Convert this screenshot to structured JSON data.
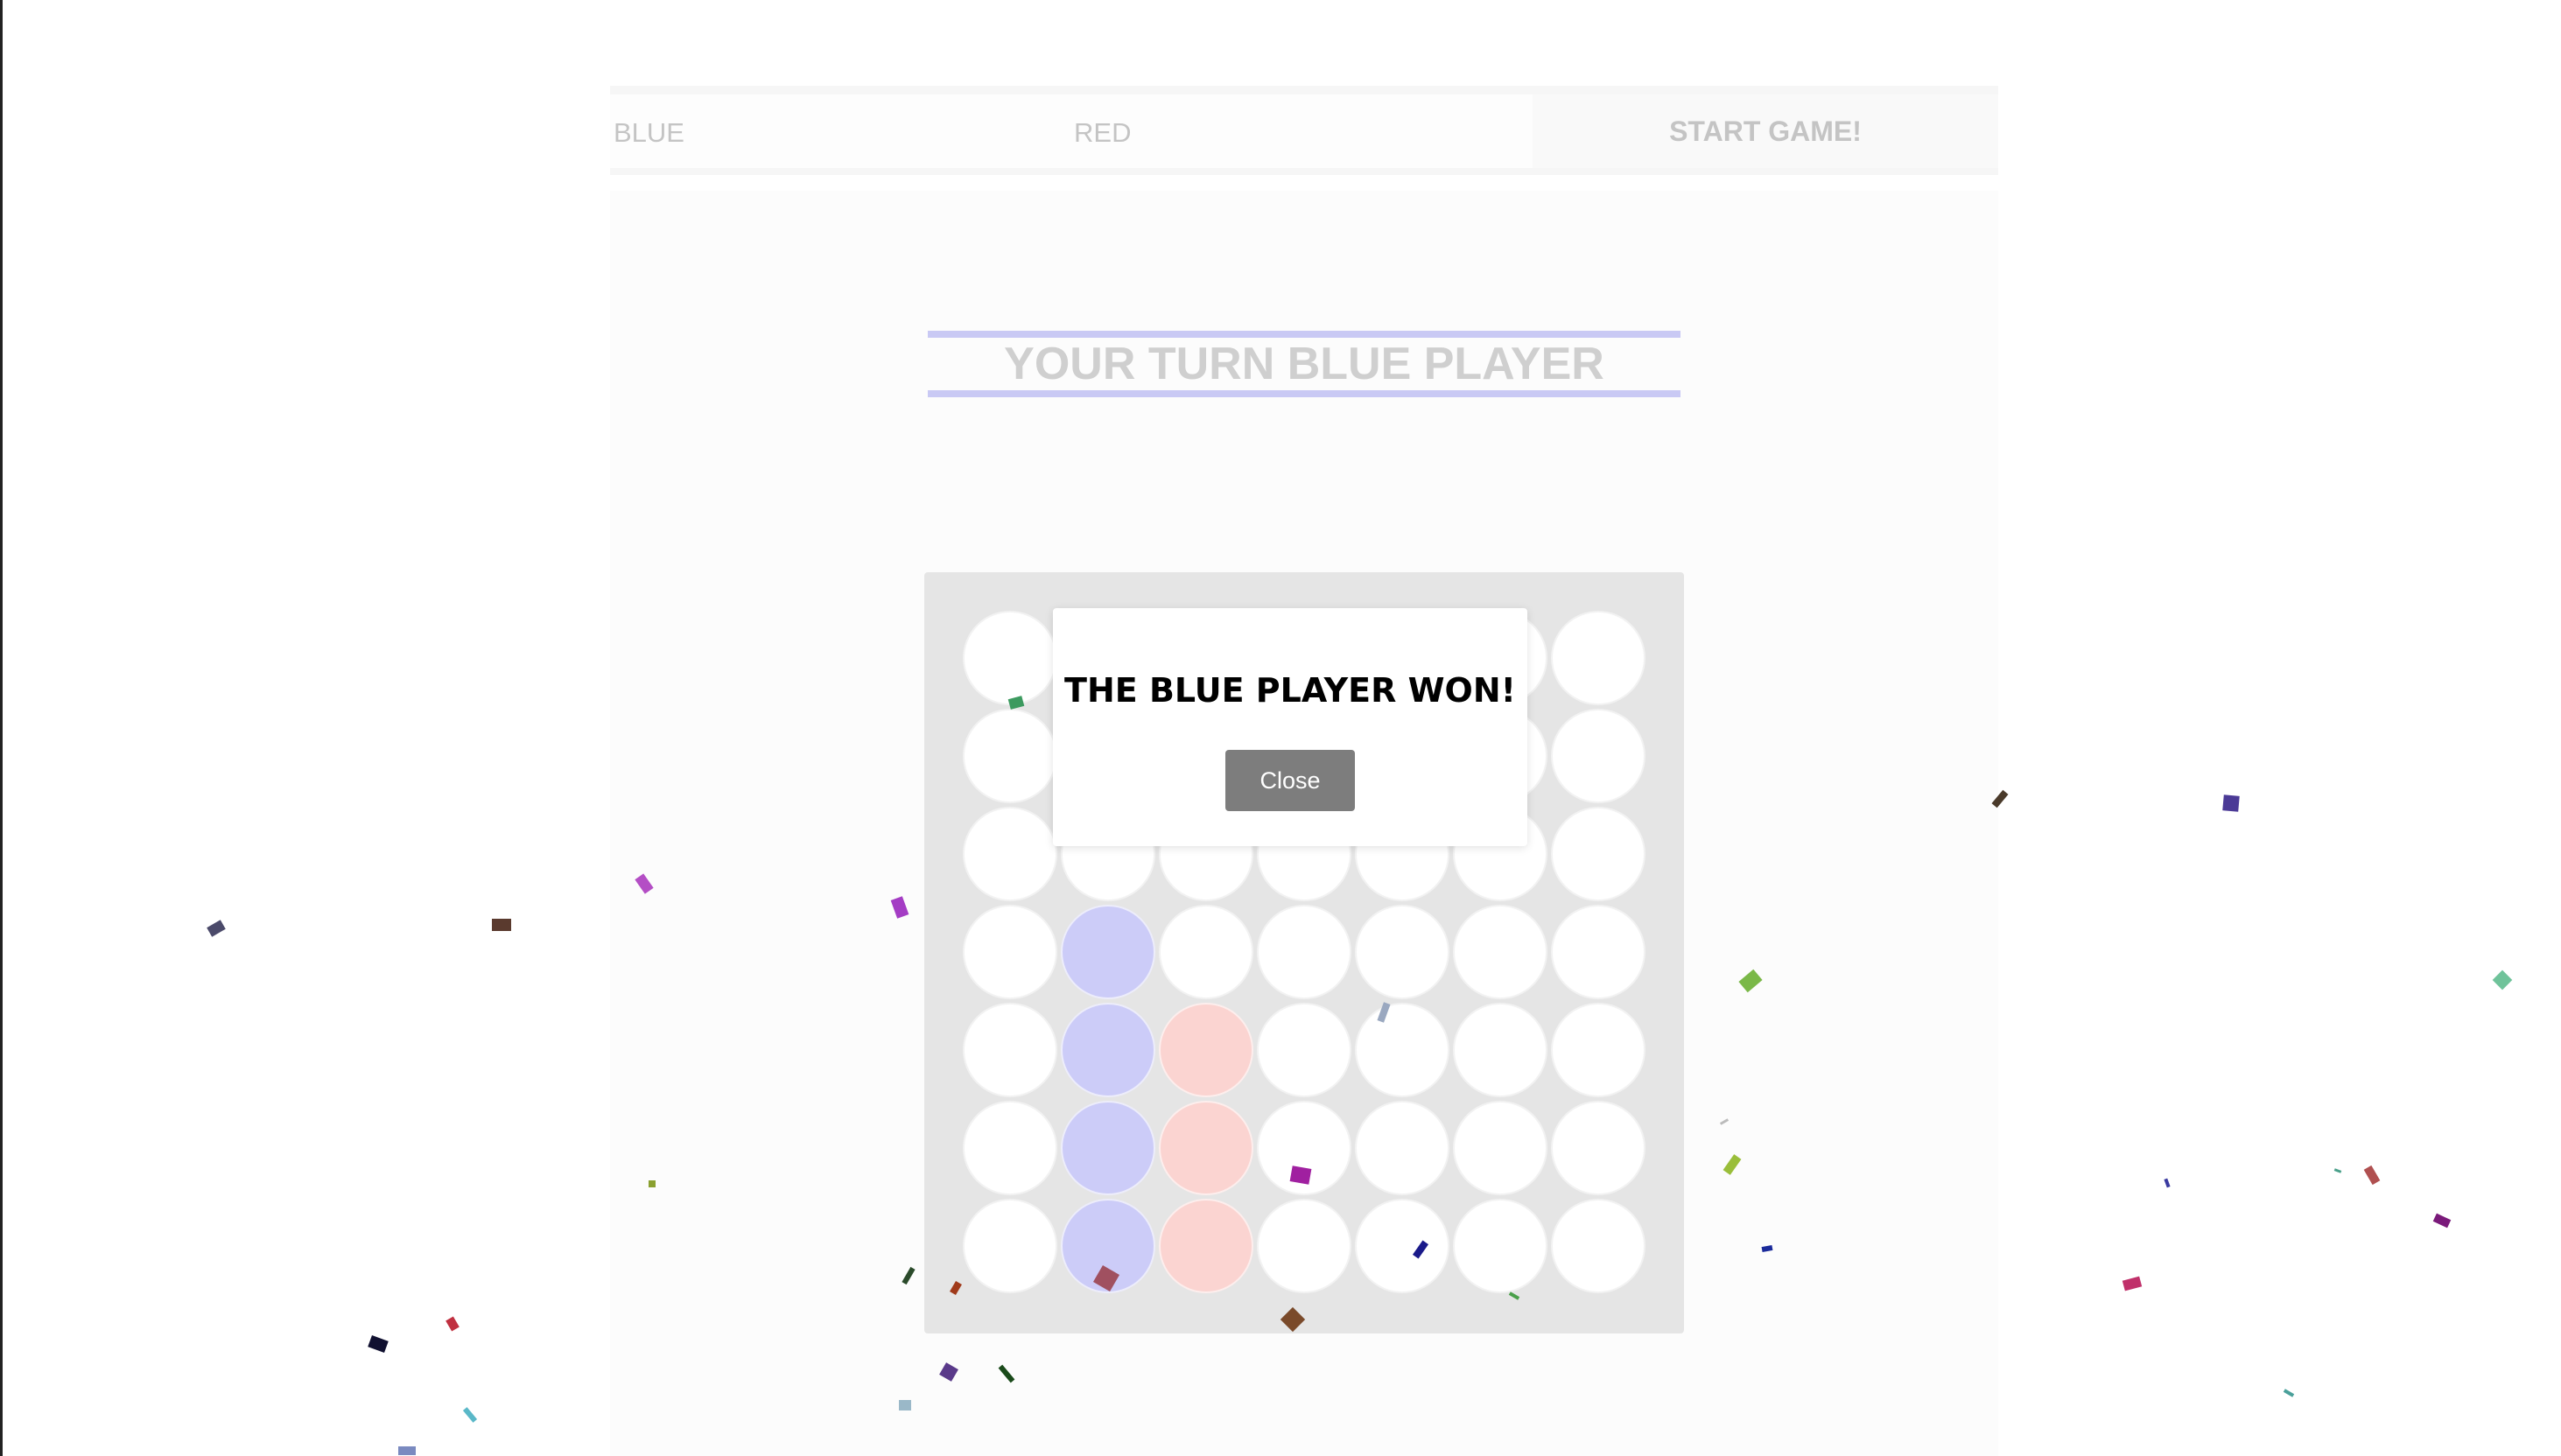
{
  "header": {
    "blue_label": "BLUE",
    "red_label": "RED",
    "start_label": "START GAME!"
  },
  "turn": {
    "text": "YOUR TURN BLUE PLAYER"
  },
  "board": {
    "columns": 7,
    "rows": 7,
    "grid": [
      [
        "empty",
        "empty",
        "empty",
        "empty",
        "empty",
        "empty",
        "empty"
      ],
      [
        "empty",
        "empty",
        "empty",
        "empty",
        "empty",
        "empty",
        "empty"
      ],
      [
        "empty",
        "empty",
        "empty",
        "empty",
        "empty",
        "empty",
        "empty"
      ],
      [
        "empty",
        "blue",
        "empty",
        "empty",
        "empty",
        "empty",
        "empty"
      ],
      [
        "empty",
        "blue",
        "red",
        "empty",
        "empty",
        "empty",
        "empty"
      ],
      [
        "empty",
        "blue",
        "red",
        "empty",
        "empty",
        "empty",
        "empty"
      ],
      [
        "empty",
        "blue",
        "red",
        "empty",
        "empty",
        "empty",
        "empty"
      ]
    ]
  },
  "modal": {
    "title": "THE BLUE PLAYER WON!",
    "close_label": "Close"
  },
  "colors": {
    "blue_piece": "#ccccf8",
    "red_piece": "#fbd4d1",
    "banner_line": "#c9c9f4",
    "board_bg": "#e5e5e5",
    "close_button": "#7d7d7d"
  }
}
